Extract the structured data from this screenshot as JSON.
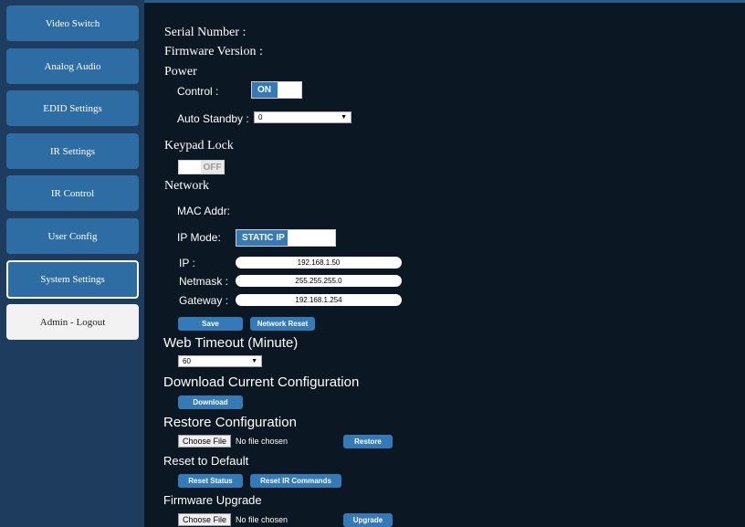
{
  "sidebar": {
    "items": [
      {
        "label": "Video Switch"
      },
      {
        "label": "Analog Audio"
      },
      {
        "label": "EDID Settings"
      },
      {
        "label": "IR Settings"
      },
      {
        "label": "IR Control"
      },
      {
        "label": "User Config"
      },
      {
        "label": "System Settings"
      },
      {
        "label": "Admin - Logout"
      }
    ],
    "active": "System Settings"
  },
  "info": {
    "serial_label": "Serial Number :",
    "firmware_label": "Firmware Version :"
  },
  "power": {
    "heading": "Power",
    "control_label": "Control :",
    "control_state": "ON",
    "auto_standby_label": "Auto Standby :",
    "auto_standby_value": "0"
  },
  "keypad": {
    "heading": "Keypad Lock",
    "state": "OFF"
  },
  "network": {
    "heading": "Network",
    "mac_label": "MAC Addr:",
    "ip_mode_label": "IP Mode:",
    "ip_mode_value": "STATIC IP",
    "ip_label": "IP :",
    "ip_value": "192.168.1.50",
    "netmask_label": "Netmask :",
    "netmask_value": "255.255.255.0",
    "gateway_label": "Gateway :",
    "gateway_value": "192.168.1.254",
    "save_label": "Save",
    "reset_label": "Network Reset"
  },
  "web_timeout": {
    "heading": "Web Timeout (Minute)",
    "value": "60"
  },
  "download": {
    "heading": "Download Current Configuration",
    "button_label": "Download"
  },
  "restore": {
    "heading": "Restore Configuration",
    "choose_label": "Choose File",
    "no_file": "No file chosen",
    "button_label": "Restore"
  },
  "reset_default": {
    "heading": "Reset to Default",
    "status_label": "Reset Status",
    "ir_label": "Reset IR Commands"
  },
  "firmware_upgrade": {
    "heading": "Firmware Upgrade",
    "choose_label": "Choose File",
    "no_file": "No file chosen",
    "button_label": "Upgrade"
  },
  "colors": {
    "sidebar_bg": "#1d3c5e",
    "nav_button": "#2e6da4",
    "main_bg": "#0b1722",
    "accent": "#337ab7"
  }
}
